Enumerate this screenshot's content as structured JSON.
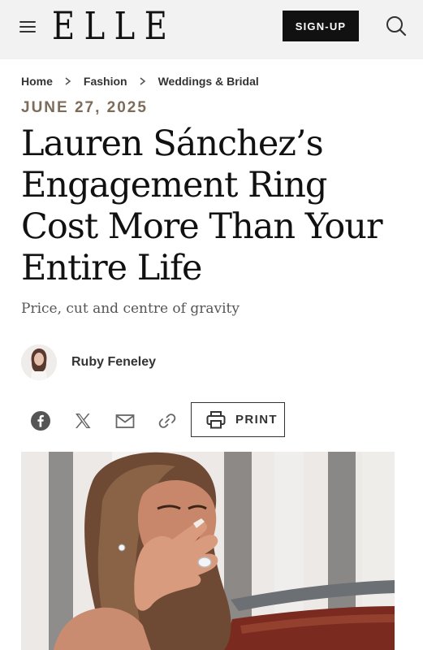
{
  "header": {
    "logo": "ELLE",
    "signup_label": "SIGN-UP",
    "menu_icon": "hamburger-menu-icon",
    "search_icon": "search-icon"
  },
  "breadcrumb": {
    "items": [
      "Home",
      "Fashion",
      "Weddings & Bridal"
    ]
  },
  "article": {
    "date": "JUNE 27, 2025",
    "headline": "Lauren Sánchez’s Engagement Ring Cost More Than Your Entire Life",
    "dek": "Price, cut and centre of gravity",
    "author": "Ruby Feneley"
  },
  "share": {
    "icons": [
      "facebook-icon",
      "x-icon",
      "email-icon",
      "link-icon"
    ],
    "print_label": "PRINT"
  },
  "colors": {
    "date_accent": "#7d6c59",
    "header_bg": "#f2f2f2",
    "button_bg": "#111111"
  }
}
